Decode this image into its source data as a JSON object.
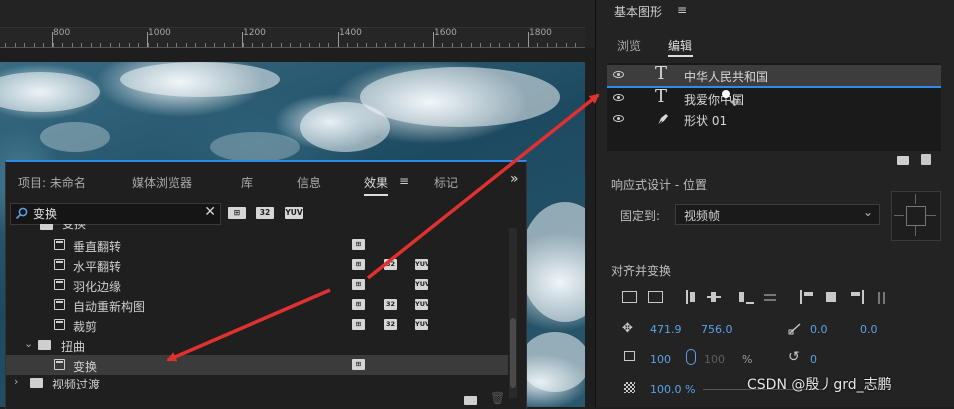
{
  "ruler": {
    "labels": [
      "800",
      "1000",
      "1200",
      "1400",
      "1600",
      "1800"
    ]
  },
  "effects_panel": {
    "tabs": [
      "项目: 未命名",
      "媒体浏览器",
      "库",
      "信息",
      "效果",
      "标记"
    ],
    "active_tab": "效果",
    "overflow": "»",
    "menu_icon": "≡",
    "search": {
      "value": "变换",
      "placeholder": ""
    },
    "filter_badges": [
      "32",
      "YUV"
    ],
    "tree": {
      "group_cut_label": "变换",
      "items": [
        {
          "label": "垂直翻转",
          "badges": [
            "accel"
          ]
        },
        {
          "label": "水平翻转",
          "badges": [
            "accel",
            "32",
            "YUV"
          ]
        },
        {
          "label": "羽化边缘",
          "badges": [
            "accel",
            "",
            "YUV"
          ]
        },
        {
          "label": "自动重新构图",
          "badges": [
            "accel",
            "32",
            "YUV"
          ]
        },
        {
          "label": "裁剪",
          "badges": [
            "accel",
            "32",
            "YUV"
          ]
        }
      ],
      "folder": {
        "label": "扭曲",
        "expanded": true
      },
      "selected_item": {
        "label": "变换",
        "badges": [
          "accel"
        ]
      },
      "next_folder": {
        "label": "视频过渡",
        "expanded": false
      }
    }
  },
  "graphics_panel": {
    "title": "基本图形",
    "menu_icon": "≡",
    "tabs": [
      "浏览",
      "编辑"
    ],
    "active_tab": "编辑",
    "layers": [
      {
        "type": "T",
        "name": "中华人民共和国",
        "selected": true
      },
      {
        "type": "T",
        "name": "我爱你中国",
        "selected": false
      },
      {
        "type": "pen",
        "name": "形状 01",
        "selected": false
      }
    ],
    "responsive": {
      "title": "响应式设计 - 位置",
      "pin_label": "固定到:",
      "pin_value": "视频帧"
    },
    "align": {
      "title": "对齐并变换",
      "position_x": "471.9",
      "position_y": "756.0",
      "anchor_x": "0.0",
      "anchor_y": "0.0",
      "scale": "100",
      "scale_disabled": "100",
      "percent_sign": "%",
      "rotation": "0",
      "opacity": "100.0 %"
    }
  },
  "watermark": "CSDN @殷丿grd_志鹏",
  "colors": {
    "accent": "#2d8ceb",
    "value_blue": "#5aa2e6",
    "arrow_red": "#e03030"
  }
}
